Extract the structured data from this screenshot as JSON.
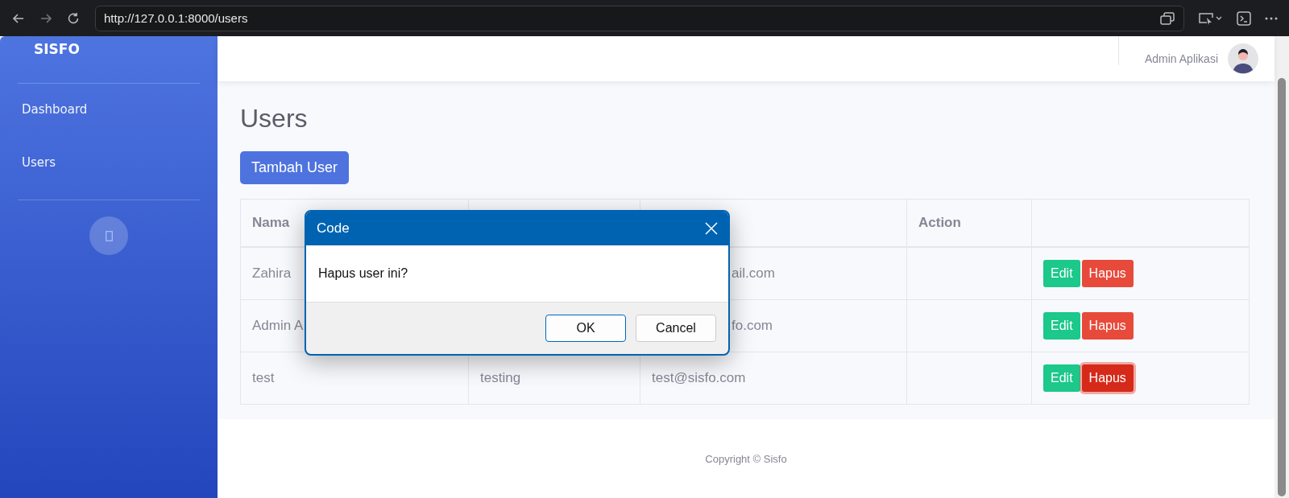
{
  "browser": {
    "url": "http://127.0.0.1:8000/users"
  },
  "sidebar": {
    "brand": "SISFO",
    "items": [
      {
        "label": "Dashboard"
      },
      {
        "label": "Users"
      }
    ]
  },
  "topbar": {
    "user_name": "Admin Aplikasi"
  },
  "page": {
    "title": "Users",
    "add_button": "Tambah User"
  },
  "table": {
    "columns": [
      "Nama",
      "",
      "",
      "Action",
      ""
    ],
    "rows": [
      {
        "cells": [
          {
            "text": "Zahira",
            "kind": "plain"
          },
          {
            "text": "",
            "kind": "plain"
          },
          {
            "text": "ail.com",
            "kind": "partial"
          },
          {
            "text": "",
            "kind": "plain"
          }
        ],
        "edit": "Edit",
        "delete": {
          "label": "Hapus",
          "focused": false
        }
      },
      {
        "cells": [
          {
            "text": "Admin A",
            "kind": "plain"
          },
          {
            "text": "",
            "kind": "plain"
          },
          {
            "text": "fo.com",
            "kind": "partial"
          },
          {
            "text": "",
            "kind": "plain"
          }
        ],
        "edit": "Edit",
        "delete": {
          "label": "Hapus",
          "focused": false
        }
      },
      {
        "cells": [
          {
            "text": "test",
            "kind": "plain"
          },
          {
            "text": "testing",
            "kind": "plain"
          },
          {
            "text": "test@sisfo.com",
            "kind": "plain"
          },
          {
            "text": "",
            "kind": "plain"
          }
        ],
        "edit": "Edit",
        "delete": {
          "label": "Hapus",
          "focused": true
        }
      }
    ]
  },
  "dialog": {
    "title": "Code",
    "message": "Hapus user ini?",
    "buttons": [
      {
        "label": "OK",
        "selected": true
      },
      {
        "label": "Cancel",
        "selected": false
      }
    ]
  },
  "footer": {
    "copyright": "Copyright © Sisfo"
  }
}
